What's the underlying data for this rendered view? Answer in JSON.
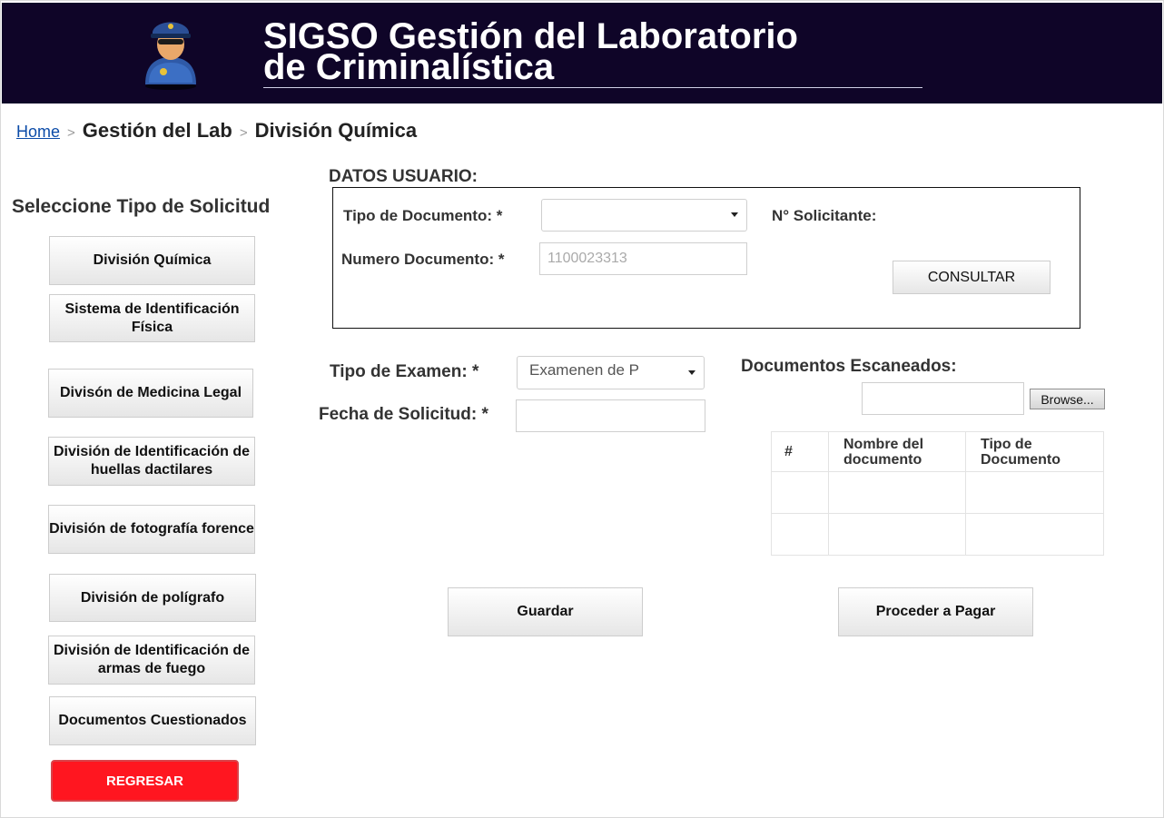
{
  "header": {
    "title_line1": "SIGSO  Gestión del Laboratorio",
    "title_line2": "de Criminalística"
  },
  "breadcrumb": {
    "home": "Home",
    "separator": ">",
    "item1": "Gestión del Lab",
    "item2": "División Química"
  },
  "sidebar": {
    "title": "Seleccione Tipo de Solicitud",
    "buttons": [
      "División Química",
      "Sistema de Identificación Física",
      "Divisón de Medicina Legal",
      "División de Identificación de huellas dactilares",
      "División de fotografía forence",
      "División de polígrafo",
      "División de Identificación de armas de fuego",
      "Documentos Cuestionados"
    ],
    "back_label": "REGRESAR"
  },
  "user_data": {
    "section_title": "DATOS USUARIO:",
    "doc_type_label": "Tipo de Documento: *",
    "doc_type_value": "",
    "solicitante_label": "N° Solicitante:",
    "doc_number_label": "Numero Documento: *",
    "doc_number_placeholder": "1100023313",
    "consult_label": "CONSULTAR"
  },
  "exam": {
    "type_label": "Tipo de Examen: *",
    "type_value": "Examenen de P",
    "date_label": "Fecha de Solicitud: *",
    "date_value": ""
  },
  "documents": {
    "label": "Documentos Escaneados:",
    "file_value": "",
    "browse_label": "Browse...",
    "columns": [
      "#",
      "Nombre del documento",
      "Tipo de Documento"
    ],
    "rows": [
      [
        "",
        "",
        ""
      ],
      [
        "",
        "",
        ""
      ]
    ]
  },
  "actions": {
    "save_label": "Guardar",
    "pay_label": "Proceder a Pagar"
  },
  "colors": {
    "header_bg": "#0f0528",
    "back_button": "#ff1620",
    "link": "#0b4ba8"
  }
}
